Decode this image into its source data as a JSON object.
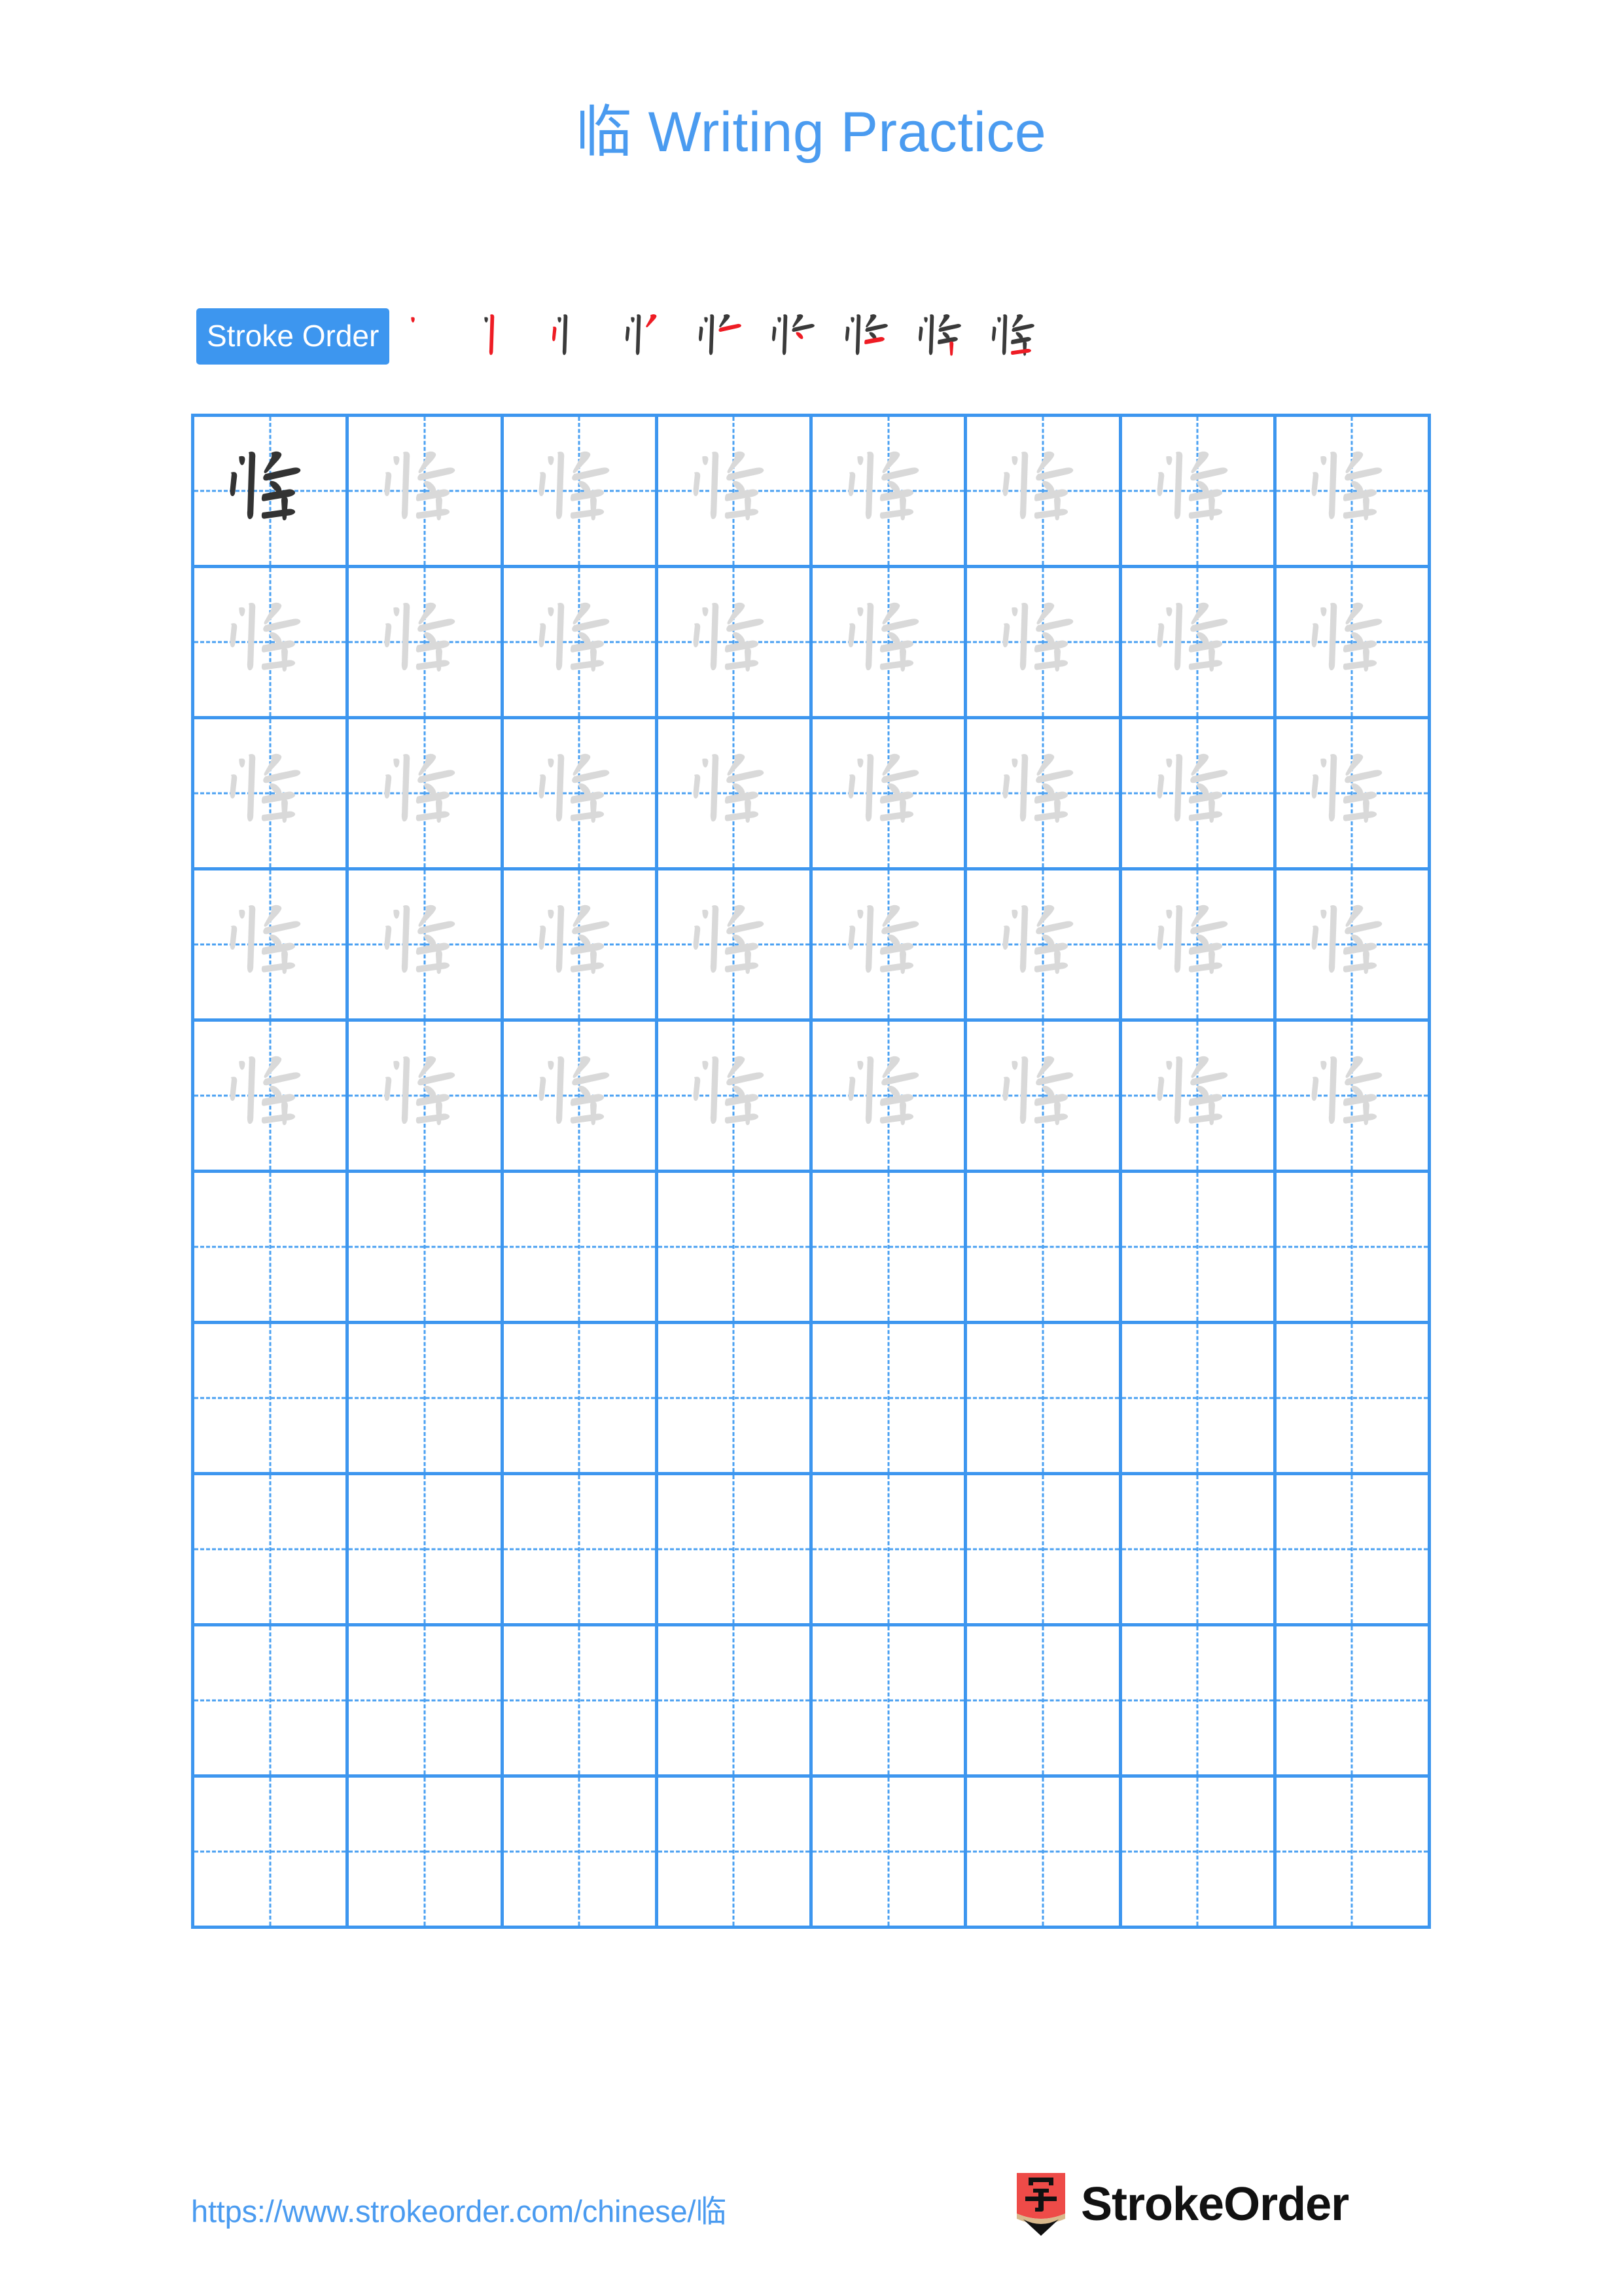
{
  "page": {
    "character": "临",
    "title_suffix": " Writing Practice",
    "title_full": "临 Writing Practice"
  },
  "colors": {
    "accent_blue": "#3d96ef",
    "title_blue": "#4a9bf0",
    "grid_line": "#3d96ef",
    "guide_dash": "#4aa0f2",
    "char_dark": "#333333",
    "char_trace": "#d9d9d9",
    "stroke_new": "#ee1c24",
    "stroke_old": "#3a3a3a",
    "logo_red": "#ee4b48",
    "logo_wood": "#d9b98c",
    "logo_tip": "#111111"
  },
  "stroke_order": {
    "badge_label": "Stroke Order",
    "total_strokes": 9,
    "steps": [
      {
        "index": 1,
        "strokes_shown": 1,
        "new_stroke": 1
      },
      {
        "index": 2,
        "strokes_shown": 2,
        "new_stroke": 2
      },
      {
        "index": 3,
        "strokes_shown": 3,
        "new_stroke": 3
      },
      {
        "index": 4,
        "strokes_shown": 4,
        "new_stroke": 4
      },
      {
        "index": 5,
        "strokes_shown": 5,
        "new_stroke": 5
      },
      {
        "index": 6,
        "strokes_shown": 6,
        "new_stroke": 6
      },
      {
        "index": 7,
        "strokes_shown": 7,
        "new_stroke": 7
      },
      {
        "index": 8,
        "strokes_shown": 8,
        "new_stroke": 8
      },
      {
        "index": 9,
        "strokes_shown": 9,
        "new_stroke": 9
      }
    ]
  },
  "grid": {
    "columns": 8,
    "rows": 10,
    "filled_rows": 5,
    "empty_rows": 5,
    "rows_data": [
      [
        "dark",
        "trace",
        "trace",
        "trace",
        "trace",
        "trace",
        "trace",
        "trace"
      ],
      [
        "trace",
        "trace",
        "trace",
        "trace",
        "trace",
        "trace",
        "trace",
        "trace"
      ],
      [
        "trace",
        "trace",
        "trace",
        "trace",
        "trace",
        "trace",
        "trace",
        "trace"
      ],
      [
        "trace",
        "trace",
        "trace",
        "trace",
        "trace",
        "trace",
        "trace",
        "trace"
      ],
      [
        "trace",
        "trace",
        "trace",
        "trace",
        "trace",
        "trace",
        "trace",
        "trace"
      ],
      [
        "empty",
        "empty",
        "empty",
        "empty",
        "empty",
        "empty",
        "empty",
        "empty"
      ],
      [
        "empty",
        "empty",
        "empty",
        "empty",
        "empty",
        "empty",
        "empty",
        "empty"
      ],
      [
        "empty",
        "empty",
        "empty",
        "empty",
        "empty",
        "empty",
        "empty",
        "empty"
      ],
      [
        "empty",
        "empty",
        "empty",
        "empty",
        "empty",
        "empty",
        "empty",
        "empty"
      ],
      [
        "empty",
        "empty",
        "empty",
        "empty",
        "empty",
        "empty",
        "empty",
        "empty"
      ]
    ]
  },
  "footer": {
    "url": "https://www.strokeorder.com/chinese/临",
    "brand_name": "StrokeOrder",
    "logo_glyph": "字"
  }
}
